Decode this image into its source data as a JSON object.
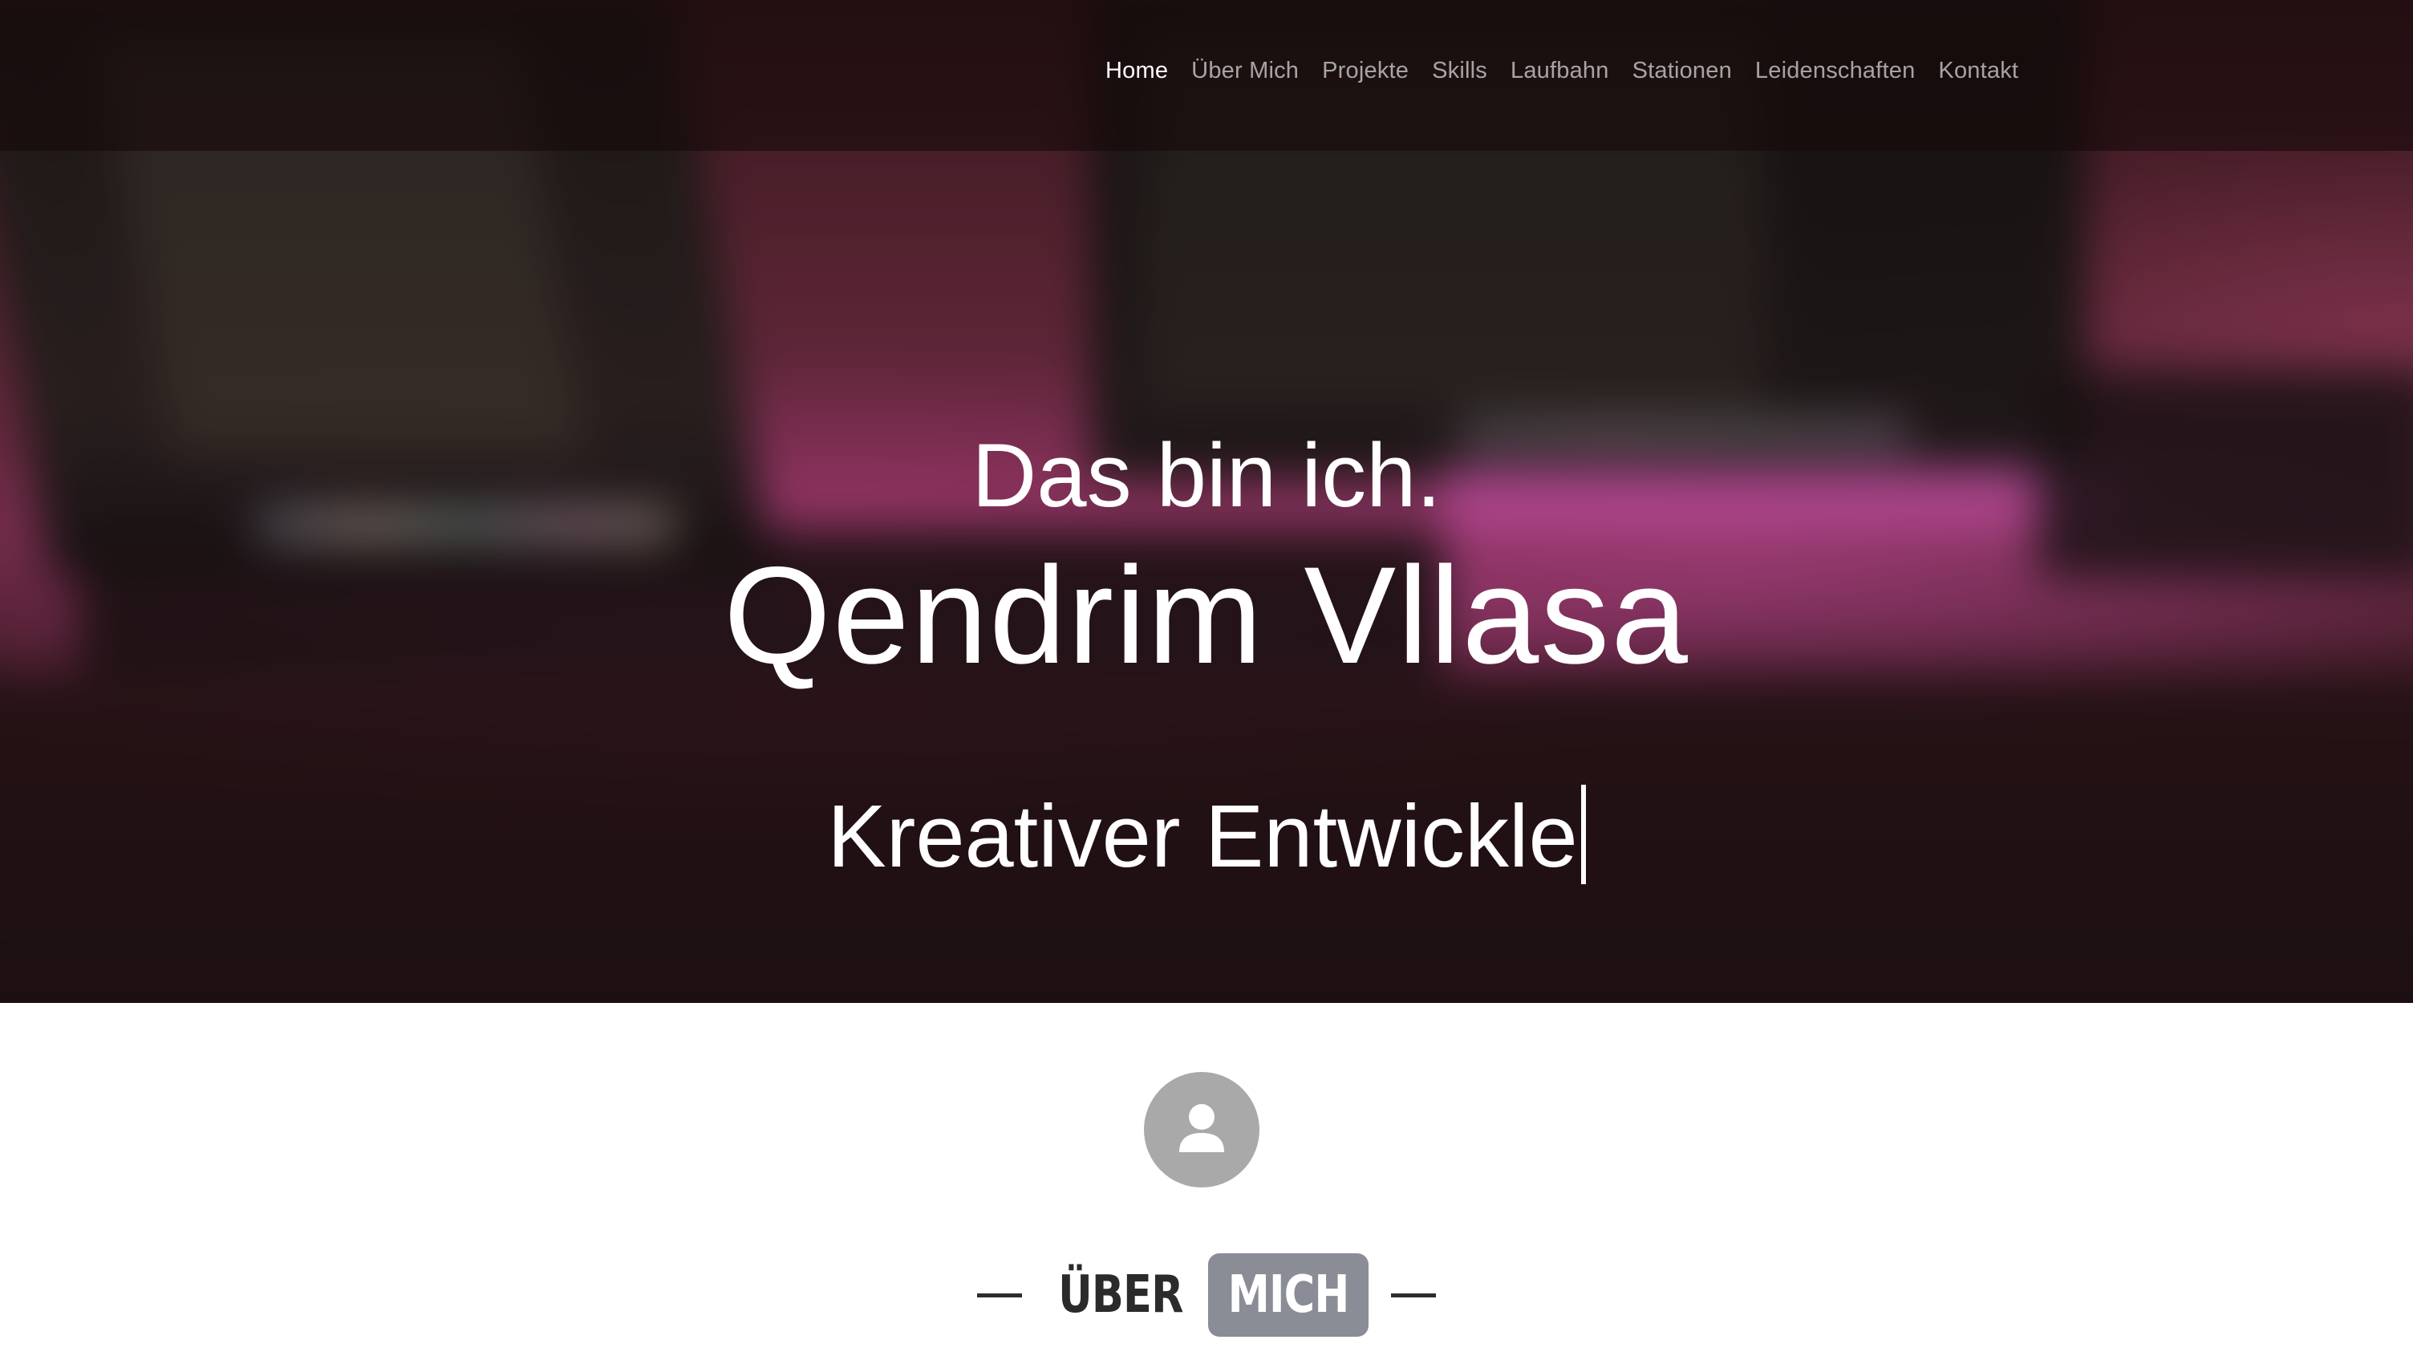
{
  "nav": {
    "items": [
      {
        "label": "Home",
        "active": true
      },
      {
        "label": "Über Mich",
        "active": false
      },
      {
        "label": "Projekte",
        "active": false
      },
      {
        "label": "Skills",
        "active": false
      },
      {
        "label": "Laufbahn",
        "active": false
      },
      {
        "label": "Stationen",
        "active": false
      },
      {
        "label": "Leidenschaften",
        "active": false
      },
      {
        "label": "Kontakt",
        "active": false
      }
    ]
  },
  "hero": {
    "intro": "Das bin ich.",
    "name": "Qendrim Vllasa",
    "typed_text": "Kreativer Entwickle"
  },
  "about": {
    "avatar_icon": "user-icon",
    "heading_word": "ÜBER",
    "heading_highlight": "MICH"
  },
  "colors": {
    "nav_active": "#ffffff",
    "nav_inactive": "#b8b0b0",
    "avatar_bg": "#a9a9a9",
    "heading_text": "#2b2b2b",
    "heading_highlight_bg": "#8a8d96"
  }
}
